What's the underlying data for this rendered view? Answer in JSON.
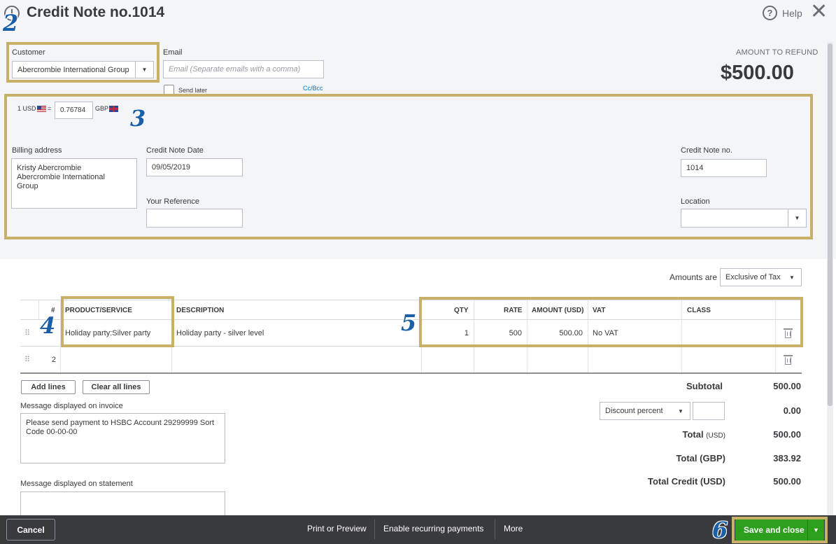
{
  "header": {
    "title": "Credit Note no.1014",
    "help_label": "Help",
    "close_glyph": "✕"
  },
  "customer": {
    "label": "Customer",
    "value": "Abercrombie International Group"
  },
  "email": {
    "label": "Email",
    "placeholder": "Email (Separate emails with a comma)",
    "send_later_label": "Send later",
    "cc_bcc_label": "Cc/Bcc"
  },
  "refund": {
    "label": "AMOUNT TO REFUND",
    "amount": "$500.00"
  },
  "exchange": {
    "base": "1 USD",
    "equals": "=",
    "rate": "0.76784",
    "target": "GBP"
  },
  "billing": {
    "label": "Billing address",
    "lines": [
      "Kristy Abercrombie",
      "Abercrombie International",
      "Group"
    ]
  },
  "credit_note_date": {
    "label": "Credit Note Date",
    "value": "09/05/2019"
  },
  "your_reference": {
    "label": "Your Reference",
    "value": ""
  },
  "credit_note_no": {
    "label": "Credit Note no.",
    "value": "1014"
  },
  "location": {
    "label": "Location",
    "value": ""
  },
  "amounts_are": {
    "label": "Amounts are",
    "value": "Exclusive of Tax"
  },
  "table": {
    "columns": {
      "num": "#",
      "product": "PRODUCT/SERVICE",
      "description": "DESCRIPTION",
      "qty": "QTY",
      "rate": "RATE",
      "amount": "AMOUNT (USD)",
      "vat": "VAT",
      "class": "CLASS"
    },
    "rows": [
      {
        "num": "1",
        "product": "Holiday party:Silver party",
        "description": "Holiday party - silver level",
        "qty": "1",
        "rate": "500",
        "amount": "500.00",
        "vat": "No VAT",
        "class": ""
      },
      {
        "num": "2",
        "product": "",
        "description": "",
        "qty": "",
        "rate": "",
        "amount": "",
        "vat": "",
        "class": ""
      }
    ]
  },
  "actions": {
    "add_lines": "Add lines",
    "clear_all_lines": "Clear all lines"
  },
  "messages": {
    "invoice_label": "Message displayed on invoice",
    "invoice_text": "Please send payment to HSBC Account 29299999 Sort Code 00-00-00",
    "statement_label": "Message displayed on statement",
    "statement_text": ""
  },
  "summary": {
    "subtotal_label": "Subtotal",
    "subtotal_value": "500.00",
    "discount_type": "Discount percent",
    "discount_input": "",
    "discount_value": "0.00",
    "total_label": "Total",
    "total_usd_unit": "(USD)",
    "total_value": "500.00",
    "total_gbp_label": "Total",
    "total_gbp_unit": "(GBP)",
    "total_gbp_value": "383.92",
    "total_credit_label": "Total Credit (USD)",
    "total_credit_value": "500.00"
  },
  "footer": {
    "cancel": "Cancel",
    "print_preview": "Print or Preview",
    "recurring": "Enable recurring payments",
    "more": "More",
    "save_close": "Save and close"
  },
  "annotations": {
    "step2": "2",
    "step3": "3",
    "step4": "4",
    "step5": "5",
    "step6": "6"
  },
  "colors": {
    "callout": "#c8b068",
    "step_number": "#1b5fa8",
    "save_button": "#2ca01c",
    "footer_bar": "#393a3d"
  }
}
